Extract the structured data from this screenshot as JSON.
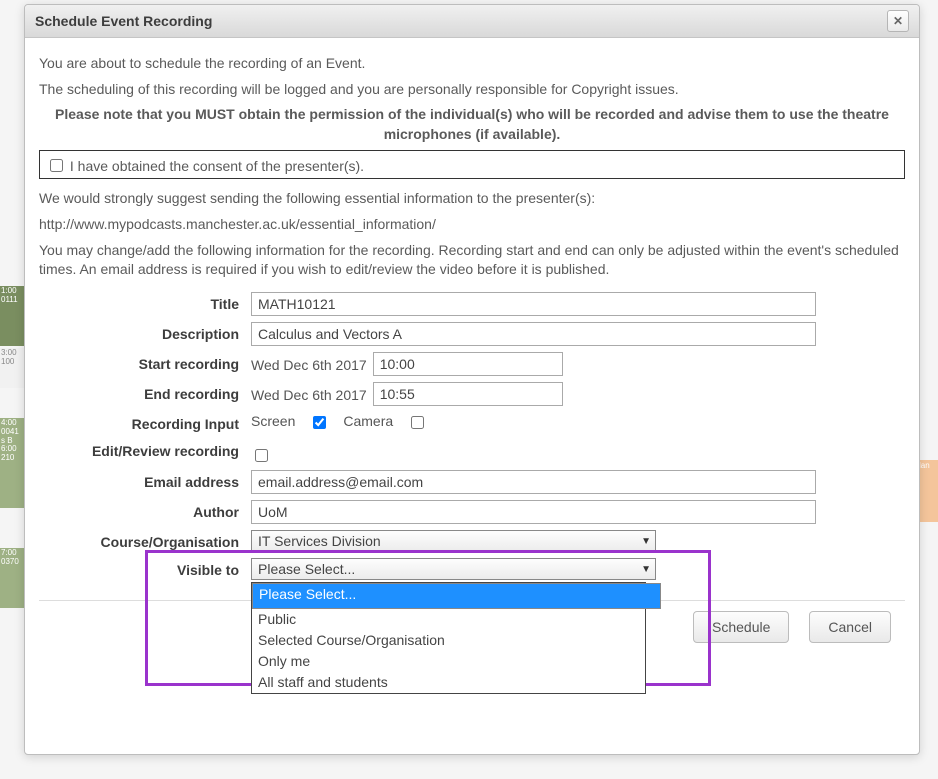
{
  "dialog": {
    "title": "Schedule Event Recording",
    "close_icon": "✕",
    "intro1": "You are about to schedule the recording of an Event.",
    "intro2": "The scheduling of this recording will be logged and you are personally responsible for Copyright issues.",
    "note_bold": "Please note that you MUST obtain the permission of the individual(s) who will be recorded and advise them to use the theatre microphones (if available).",
    "consent_label": "I have obtained the consent of the presenter(s).",
    "suggest_text": "We would strongly suggest sending the following essential information to the presenter(s):",
    "suggest_link": "http://www.mypodcasts.manchester.ac.uk/essential_information/",
    "change_text": "You may change/add the following information for the recording. Recording start and end can only be adjusted within the event's scheduled times. An email address is required if you wish to edit/review the video before it is published."
  },
  "form": {
    "title_label": "Title",
    "title_value": "MATH10121",
    "desc_label": "Description",
    "desc_value": "Calculus and Vectors A",
    "start_label": "Start recording",
    "start_date": "Wed Dec 6th 2017",
    "start_time": "10:00",
    "end_label": "End recording",
    "end_date": "Wed Dec 6th 2017",
    "end_time": "10:55",
    "input_label": "Recording Input",
    "screen_label": "Screen",
    "camera_label": "Camera",
    "review_label": "Edit/Review recording",
    "email_label": "Email address",
    "email_value": "email.address@email.com",
    "author_label": "Author",
    "author_value": "UoM",
    "course_label": "Course/Organisation",
    "course_value": "IT Services Division",
    "visible_label": "Visible to",
    "visible_value": "Please Select...",
    "visible_options": [
      "Please Select...",
      "Public",
      "Selected Course/Organisation",
      "Only me",
      "All staff and students"
    ]
  },
  "buttons": {
    "schedule": "Schedule",
    "cancel": "Cancel"
  },
  "bg": {
    "c1": "1:00\n0111",
    "c2": "3:00\n100",
    "c3": "4:00\n0041\ns B\n6:00\n210",
    "c4": "7:00\n0370",
    "r1": "lan"
  }
}
